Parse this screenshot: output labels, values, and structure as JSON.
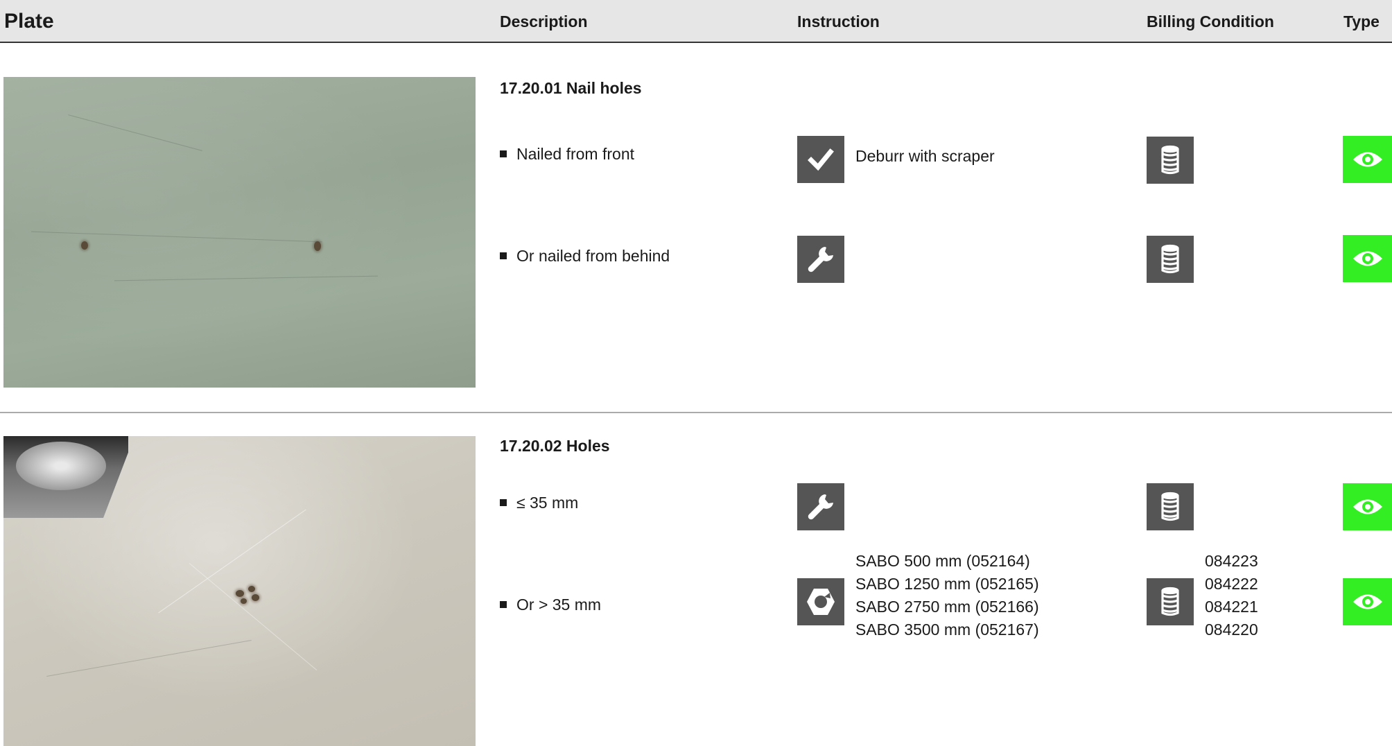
{
  "header": {
    "plate": "Plate",
    "description": "Description",
    "instruction": "Instruction",
    "billing": "Billing Condition",
    "type": "Type"
  },
  "sections": [
    {
      "title": "17.20.01 Nail holes",
      "rows": [
        {
          "description": "Nailed from front",
          "instruction_icon": "checkmark-icon",
          "instruction_text": "Deburr with scraper",
          "billing_icon": "coin-stack-icon",
          "type_icon": "eye-icon"
        },
        {
          "description": "Or nailed from behind",
          "instruction_icon": "wrench-icon",
          "instruction_text": "",
          "billing_icon": "coin-stack-icon",
          "type_icon": "eye-icon"
        }
      ]
    },
    {
      "title": "17.20.02 Holes",
      "rows": [
        {
          "description": "≤ 35 mm",
          "instruction_icon": "wrench-icon",
          "instruction_text": "",
          "billing_icon": "coin-stack-icon",
          "type_icon": "eye-icon"
        },
        {
          "description": "Or > 35 mm",
          "instruction_icon": "hex-nut-icon",
          "instruction_lines": [
            "SABO 500 mm (052164)",
            "SABO 1250 mm (052165)",
            "SABO 2750 mm (052166)",
            "SABO 3500 mm (052167)"
          ],
          "billing_icon": "coin-stack-icon",
          "billing_lines": [
            "084223",
            "084222",
            "084221",
            "084220"
          ],
          "type_icon": "eye-icon"
        }
      ]
    }
  ],
  "colors": {
    "icon_box": "#555555",
    "type_box": "#33ee22",
    "header_bg": "#e6e6e6"
  }
}
